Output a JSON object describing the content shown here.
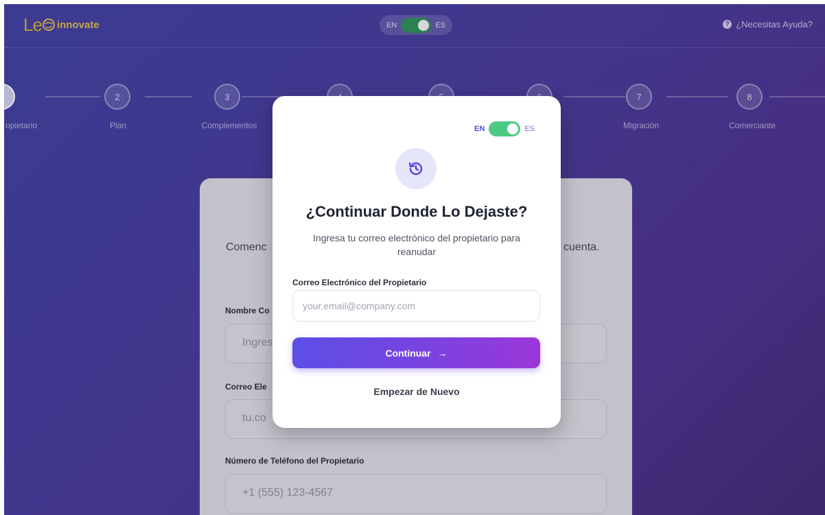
{
  "header": {
    "logo_le": "Le",
    "logo_text": "innovate",
    "lang_en": "EN",
    "lang_es": "ES",
    "help": "¿Necesitas Ayuda?",
    "help_icon": "question-circle-icon"
  },
  "stepper": {
    "steps": [
      {
        "number": "",
        "label": "opietario"
      },
      {
        "number": "2",
        "label": "Plan"
      },
      {
        "number": "3",
        "label": "Complementos"
      },
      {
        "number": "4",
        "label": ""
      },
      {
        "number": "5",
        "label": ""
      },
      {
        "number": "6",
        "label": ""
      },
      {
        "number": "7",
        "label": "Migración"
      },
      {
        "number": "8",
        "label": "Comerciante"
      }
    ]
  },
  "background_form": {
    "subtitle_left": "Comenc",
    "subtitle_right": "cuenta.",
    "field1_label": "Nombre Co",
    "field1_placeholder": "Ingres",
    "field2_label": "Correo Ele",
    "field2_placeholder": "tu.co",
    "field3_label": "Número de Teléfono del Propietario",
    "field3_placeholder": "+1 (555) 123-4567"
  },
  "modal": {
    "lang_en": "EN",
    "lang_es": "ES",
    "icon": "history-icon",
    "title": "¿Continuar Donde Lo Dejaste?",
    "description": "Ingresa tu correo electrónico del propietario para reanudar",
    "email_label": "Correo Electrónico del Propietario",
    "email_placeholder": "your.email@company.com",
    "email_value": "",
    "continue_label": "Continuar",
    "continue_arrow": "→",
    "restart_label": "Empezar de Nuevo"
  },
  "colors": {
    "accent_gradient_start": "#5b4fe6",
    "accent_gradient_end": "#9c36d8",
    "toggle_on": "#4cc985",
    "logo_gold": "#c9a536"
  }
}
